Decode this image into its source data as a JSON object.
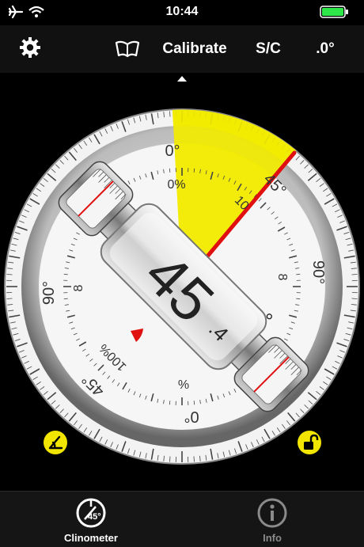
{
  "status_bar": {
    "time": "10:44",
    "airplane_icon": "airplane-icon",
    "wifi_icon": "wifi-icon",
    "battery_icon": "battery-charging-icon"
  },
  "toolbar": {
    "settings_icon": "gear-icon",
    "guide_icon": "open-book-icon",
    "calibrate_label": "Calibrate",
    "sc_label": "S/C",
    "decimal_label": ".0°"
  },
  "dial": {
    "degree_labels": [
      "0°",
      "45°",
      "90°",
      "45°",
      "90°",
      "0°"
    ],
    "percent_labels": [
      "0%",
      "10",
      "8",
      "8",
      "100%",
      "%"
    ],
    "reading_main": "45",
    "reading_decimal": ".4",
    "reading_unit": "°",
    "angle_degrees": 45.4,
    "colors": {
      "highlight": "#f2ec00",
      "needle": "#e01010",
      "face": "#f3f3f3"
    }
  },
  "corner_buttons": {
    "left_icon": "angle-reference-icon",
    "right_icon": "unlock-icon"
  },
  "tab_bar": {
    "tabs": [
      {
        "label": "Clinometer",
        "icon": "clinometer-icon",
        "badge": "45°",
        "active": true
      },
      {
        "label": "Info",
        "icon": "info-icon",
        "active": false
      }
    ]
  }
}
